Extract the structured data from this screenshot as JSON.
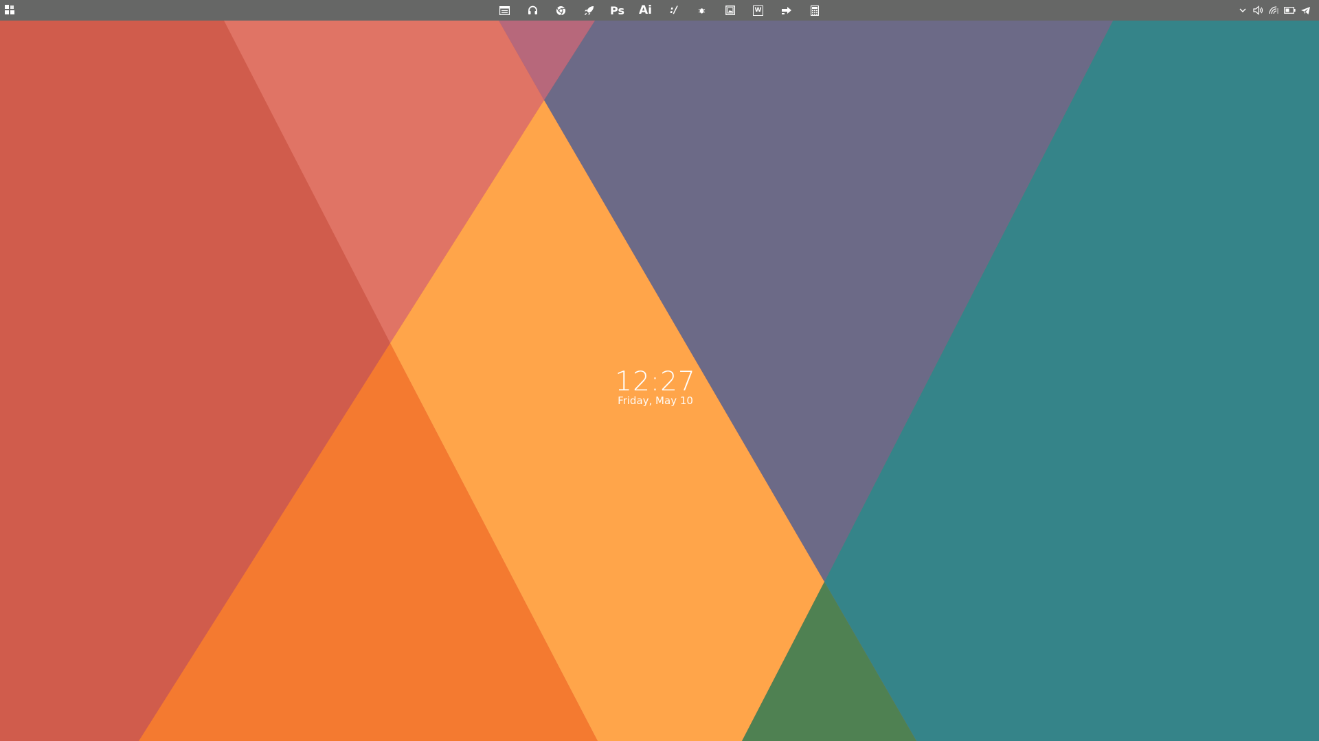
{
  "wallpaper": {
    "colors": {
      "red": "#D05C4C",
      "salmon": "#E07465",
      "pink": "#B7687B",
      "slate": "#6C6A87",
      "teal": "#358489",
      "orange": "#F47A30",
      "light_orange": "#FFA54A",
      "green": "#4F8152"
    }
  },
  "taskbar": {
    "background": "#666766",
    "start": {
      "icon": "start-menu-icon"
    },
    "apps": [
      {
        "name": "file-manager",
        "icon": "file-manager-icon"
      },
      {
        "name": "music",
        "icon": "headphones-icon"
      },
      {
        "name": "chrome",
        "icon": "chrome-icon"
      },
      {
        "name": "launcher",
        "icon": "rocket-icon"
      },
      {
        "name": "photoshop",
        "icon": "photoshop-icon",
        "label": "Ps"
      },
      {
        "name": "illustrator",
        "icon": "illustrator-icon",
        "label": "Ai"
      },
      {
        "name": "terminal",
        "icon": "terminal-icon",
        "label": ":/"
      },
      {
        "name": "bug-tool",
        "icon": "bug-icon"
      },
      {
        "name": "image-viewer",
        "icon": "image-icon"
      },
      {
        "name": "word",
        "icon": "word-icon",
        "label": "W"
      },
      {
        "name": "remote",
        "icon": "remote-icon"
      },
      {
        "name": "calculator",
        "icon": "calculator-icon"
      }
    ],
    "tray": [
      {
        "name": "overflow",
        "icon": "chevron-down-icon"
      },
      {
        "name": "volume",
        "icon": "volume-icon"
      },
      {
        "name": "network",
        "icon": "wifi-icon"
      },
      {
        "name": "battery",
        "icon": "battery-icon"
      },
      {
        "name": "telegram",
        "icon": "telegram-icon"
      }
    ]
  },
  "clock": {
    "time": "12:27",
    "date": "Friday, May 10"
  }
}
